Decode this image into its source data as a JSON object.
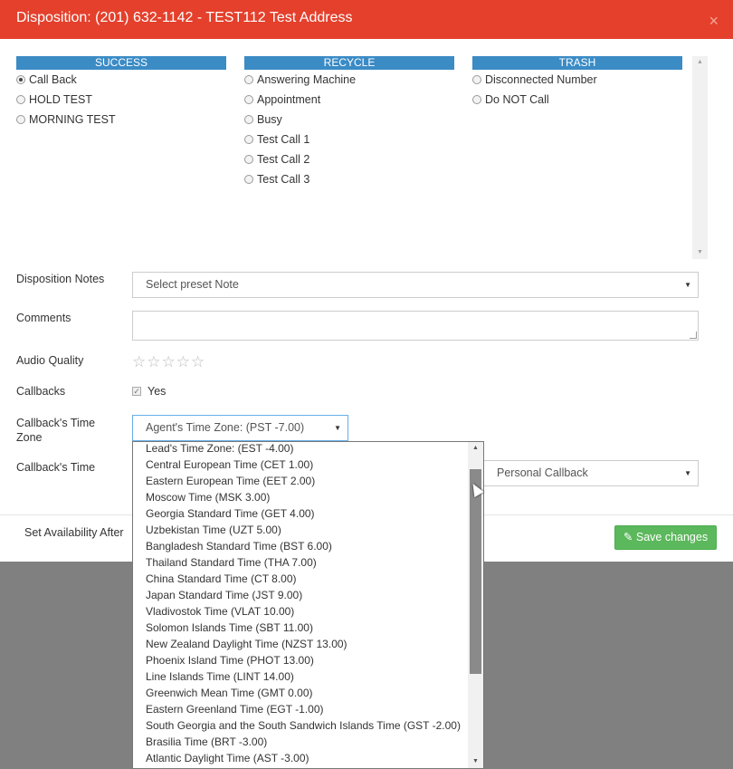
{
  "header": {
    "title": "Disposition: (201) 632-1142 - TEST112 Test Address",
    "close": "×"
  },
  "categories": [
    {
      "name": "SUCCESS",
      "options": [
        "Call Back",
        "HOLD TEST",
        "MORNING TEST"
      ]
    },
    {
      "name": "RECYCLE",
      "options": [
        "Answering Machine",
        "Appointment",
        "Busy",
        "Test Call 1",
        "Test Call 2",
        "Test Call 3"
      ]
    },
    {
      "name": "TRASH",
      "options": [
        "Disconnected Number",
        "Do NOT Call"
      ]
    }
  ],
  "selected_disposition": "Call Back",
  "form": {
    "disposition_notes_label": "Disposition Notes",
    "disposition_notes_value": "Select preset Note",
    "comments_label": "Comments",
    "audio_quality_label": "Audio Quality",
    "audio_quality_stars": "☆☆☆☆☆",
    "audio_quality_rating": 0,
    "callbacks_label": "Callbacks",
    "callbacks_checked": true,
    "callbacks_yes": "Yes",
    "callback_tz_label": "Callback's Time Zone",
    "callback_tz_value": "Agent's Time Zone: (PST -7.00)",
    "callback_time_label": "Callback's Time",
    "callback_type_value": "Personal Callback",
    "availability_label": "Set Availability After"
  },
  "save_button": "Save changes",
  "timezone_options": [
    "Lead's Time Zone: (EST -4.00)",
    "Central European Time (CET 1.00)",
    "Eastern European Time (EET 2.00)",
    "Moscow Time (MSK 3.00)",
    "Georgia Standard Time (GET 4.00)",
    "Uzbekistan Time (UZT 5.00)",
    "Bangladesh Standard Time (BST 6.00)",
    "Thailand Standard Time (THA 7.00)",
    "China Standard Time (CT 8.00)",
    "Japan Standard Time (JST 9.00)",
    "Vladivostok Time (VLAT 10.00)",
    "Solomon Islands Time (SBT 11.00)",
    "New Zealand Daylight Time (NZST 13.00)",
    "Phoenix Island Time (PHOT 13.00)",
    "Line Islands Time (LINT 14.00)",
    "Greenwich Mean Time (GMT 0.00)",
    "Eastern Greenland Time (EGT -1.00)",
    "South Georgia and the South Sandwich Islands Time (GST -2.00)",
    "Brasilia Time (BRT -3.00)",
    "Atlantic Daylight Time (AST -3.00)"
  ]
}
